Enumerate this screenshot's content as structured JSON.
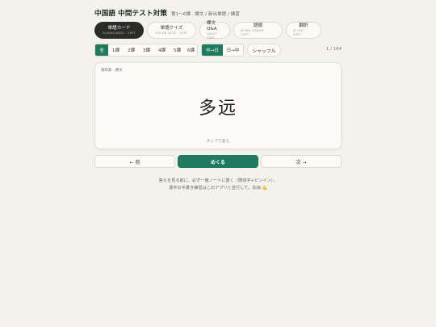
{
  "header": {
    "title": "中国語 中間テスト対策",
    "subtitle": "第1〜6課 · 課文 / 新出単語 / 練習"
  },
  "modes": [
    {
      "label": "単語カード",
      "sub": "FLASHCARDS · 20PT",
      "active": true
    },
    {
      "label": "単語クイズ",
      "sub": "VOCAB QUIZ · 20PT",
      "active": false
    },
    {
      "label": "課文Q&A",
      "sub": "Q&A/T · 20PT",
      "active": false
    },
    {
      "label": "語順",
      "sub": "WORD ORDER · 20PT",
      "active": false
    },
    {
      "label": "翻訳",
      "sub": "JP→ZH · 30PT",
      "active": false
    }
  ],
  "filters": {
    "lessons": [
      "全",
      "1課",
      "2課",
      "3課",
      "4課",
      "5課",
      "6課"
    ],
    "lesson_active": "全",
    "direction": [
      "中→日",
      "日→中"
    ],
    "direction_active": "中→日",
    "shuffle_label": "シャッフル",
    "counter": "1 / 164"
  },
  "card": {
    "tag": "第6課 · 課文",
    "word": "多远",
    "hint": "タップで答え"
  },
  "nav": {
    "prev_label": "← 前",
    "flip_label": "めくる",
    "next_label": "次 →"
  },
  "note": {
    "line1": "答えを見る前に、必ず一度ノートに書く（簡体字+ピンイン）。",
    "line2": "漢字の手書き練習はこのアプリと並行して。加油 💪"
  },
  "colors": {
    "accent": "#1f7a5e",
    "mode_active": "#2b2b28",
    "background": "#f3f2ec"
  }
}
